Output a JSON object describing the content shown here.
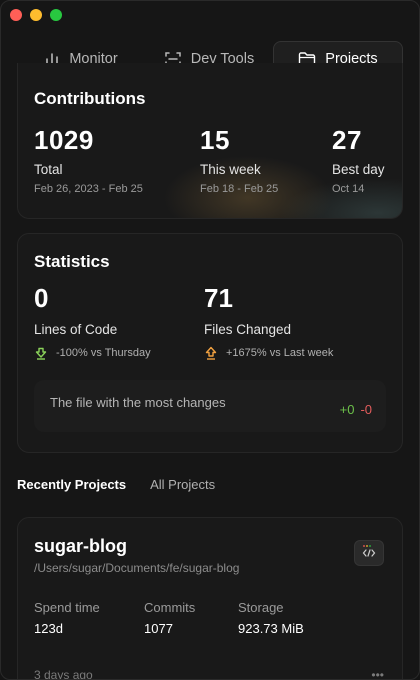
{
  "tabs": [
    {
      "label": "Monitor",
      "icon": "bar-chart-icon",
      "active": false
    },
    {
      "label": "Dev Tools",
      "icon": "scan-icon",
      "active": false
    },
    {
      "label": "Projects",
      "icon": "folder-icon",
      "active": true
    }
  ],
  "contributions": {
    "title": "Contributions",
    "total": {
      "value": "1029",
      "label": "Total",
      "range": "Feb 26, 2023 - Feb 25"
    },
    "week": {
      "value": "15",
      "label": "This week",
      "range": "Feb 18 - Feb 25"
    },
    "best": {
      "value": "27",
      "label": "Best day",
      "range": "Oct 14"
    }
  },
  "statistics": {
    "title": "Statistics",
    "lines": {
      "value": "0",
      "label": "Lines of Code",
      "delta": "-100% vs Thursday",
      "direction": "down"
    },
    "files": {
      "value": "71",
      "label": "Files Changed",
      "delta": "+1675% vs Last week",
      "direction": "up"
    },
    "most_changes": {
      "label": "The file with the most changes",
      "added": "+0",
      "removed": "-0"
    }
  },
  "project_tabs": {
    "recent": "Recently Projects",
    "all": "All Projects"
  },
  "project": {
    "name": "sugar-blog",
    "path": "/Users/sugar/Documents/fe/sugar-blog",
    "spend_label": "Spend time",
    "spend_value": "123d",
    "commits_label": "Commits",
    "commits_value": "1077",
    "storage_label": "Storage",
    "storage_value": "923.73 MiB",
    "updated": "3 days ago"
  },
  "colors": {
    "accent_green": "#6cc04a",
    "accent_red": "#e25c5c",
    "background": "#161616"
  }
}
